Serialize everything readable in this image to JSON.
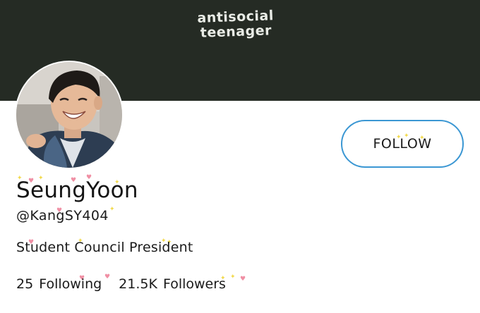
{
  "banner": {
    "line1": "antisocial",
    "line2": "teenager"
  },
  "profile": {
    "name": "SeungYoon",
    "handle": "@KangSY404",
    "bio": "Student Council President"
  },
  "follow_button": {
    "label": "FOLLOW"
  },
  "stats": {
    "following": {
      "count": "25",
      "label": "Following"
    },
    "followers": {
      "count": "21.5K",
      "label": "Followers"
    }
  },
  "colors": {
    "banner": "#252b24",
    "button_border": "#3b97d3",
    "sparkle_yellow": "#f2d94a",
    "sparkle_pink": "#f08fa4"
  }
}
